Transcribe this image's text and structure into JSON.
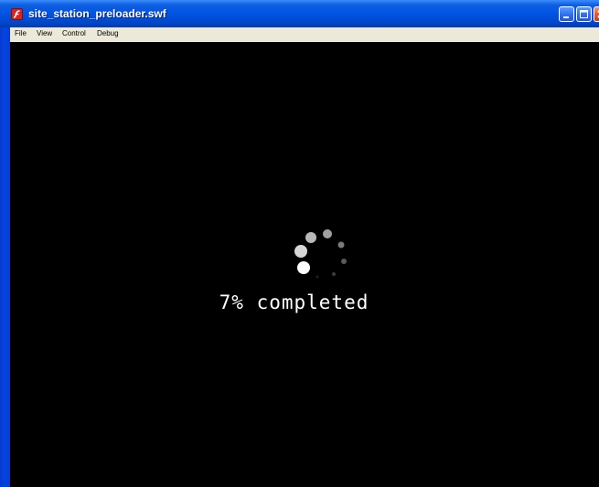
{
  "window": {
    "title": "site_station_preloader.swf",
    "app_icon": "flash-player-icon",
    "controls": [
      "minimize-icon",
      "maximize-icon",
      "close-icon"
    ]
  },
  "menubar": {
    "items": [
      {
        "label": "File"
      },
      {
        "label": "View"
      },
      {
        "label": "Control"
      },
      {
        "label": "Debug"
      }
    ]
  },
  "stage": {
    "background_color": "#000000",
    "spinner_icon": "loading-spinner-icon",
    "progress_percent": 7,
    "progress_text": "7% completed"
  }
}
